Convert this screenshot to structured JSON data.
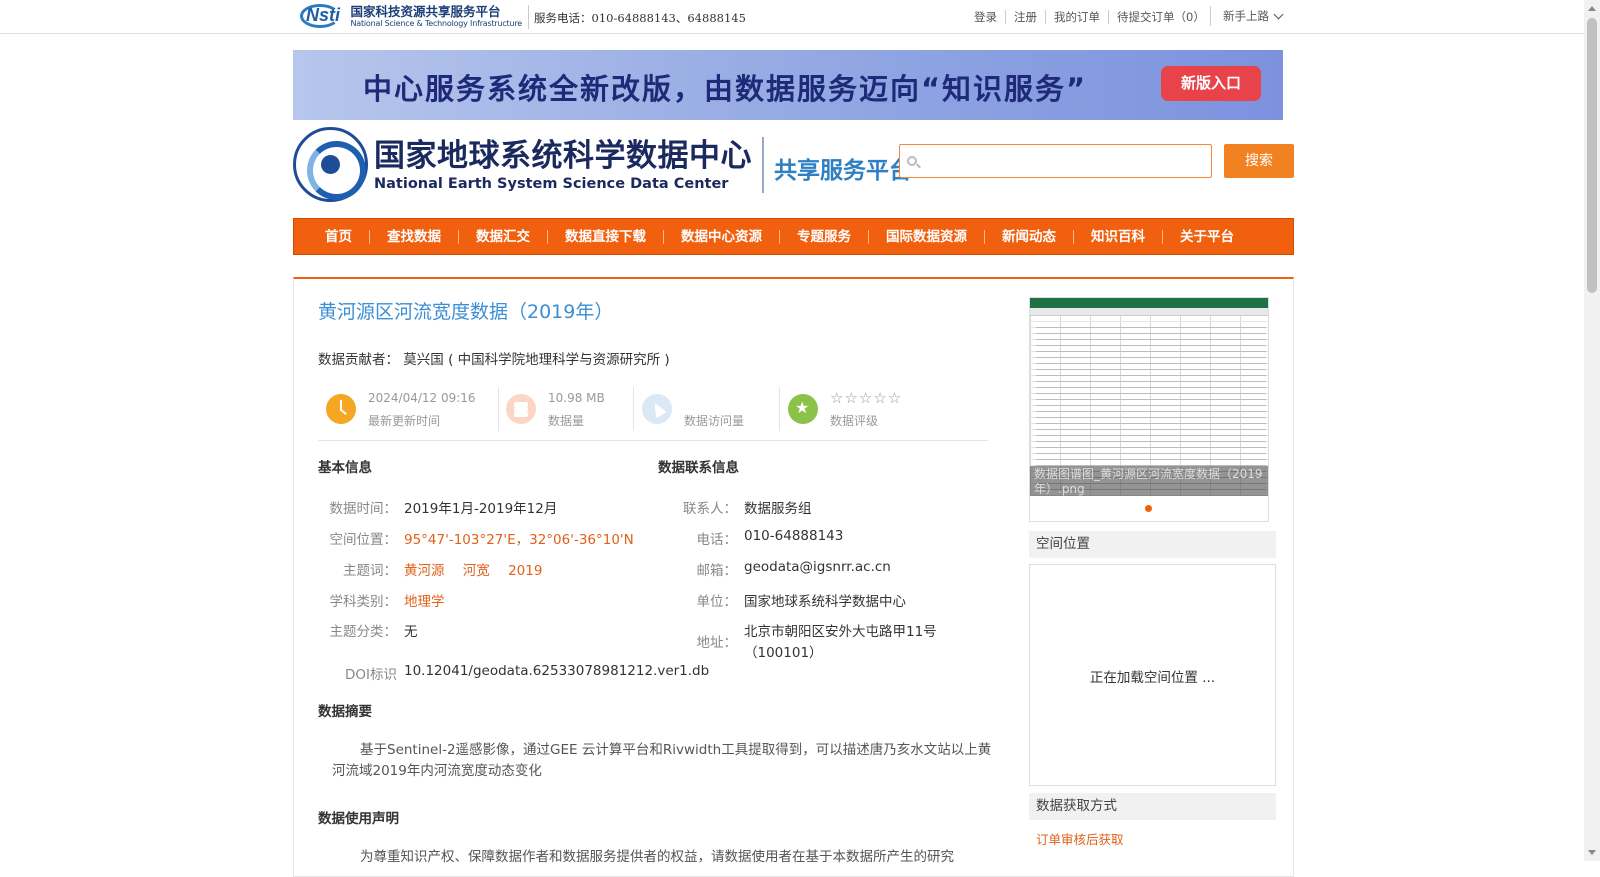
{
  "topbar": {
    "nsti_cn": "国家科技资源共享服务平台",
    "nsti_en": "National Science & Technology Infrastructure",
    "phone": "服务电话：010-64888143、64888145",
    "links": [
      "登录",
      "注册",
      "我的订单",
      "待提交订单（0）"
    ],
    "beginner": "新手上路"
  },
  "banner": {
    "text": "中心服务系统全新改版，由数据服务迈向“知识服务”",
    "button": "新版入口"
  },
  "header": {
    "logo_cn": "国家地球系统科学数据中心",
    "logo_en": "National Earth System Science Data Center",
    "platform": "共享服务平台",
    "search_placeholder": "",
    "search_button": "搜索"
  },
  "nav": [
    "首页",
    "查找数据",
    "数据汇交",
    "数据直接下载",
    "数据中心资源",
    "专题服务",
    "国际数据资源",
    "新闻动态",
    "知识百科",
    "关于平台"
  ],
  "dataset": {
    "title": "黄河源区河流宽度数据（2019年）",
    "contributor": "数据贡献者： 莫兴国 ( 中国科学院地理科学与资源研究所 )",
    "stats": {
      "updated_value": "2024/04/12 09:16",
      "updated_label": "最新更新时间",
      "size_value": "10.98 MB",
      "size_label": "数据量",
      "visits_value": "",
      "visits_label": "数据访问量",
      "rating_stars": "☆☆☆☆☆",
      "rating_label": "数据评级",
      "rating_value": 0
    },
    "basic_info": {
      "heading": "基本信息",
      "time_key": "数据时间：",
      "time_val": "2019年1月-2019年12月",
      "space_key": "空间位置：",
      "space_val": "95°47'-103°27'E，32°06'-36°10'N",
      "keywords_key": "主题词：",
      "keywords": [
        "黄河源",
        "河宽",
        "2019"
      ],
      "subject_key": "学科类别：",
      "subject_val": "地理学",
      "category_key": "主题分类：",
      "category_val": "无",
      "doi_key": "DOI标识",
      "doi_val": "10.12041/geodata.62533078981212.ver1.db"
    },
    "contact": {
      "heading": "数据联系信息",
      "person_key": "联系人：",
      "person_val": "数据服务组",
      "phone_key": "电话：",
      "phone_val": "010-64888143",
      "email_key": "邮箱：",
      "email_val": "geodata@igsnrr.ac.cn",
      "unit_key": "单位：",
      "unit_val": "国家地球系统科学数据中心",
      "address_key": "地址：",
      "address_line1": "北京市朝阳区安外大屯路甲11号",
      "address_line2": "（100101）"
    },
    "abstract_heading": "数据摘要",
    "abstract": "基于Sentinel-2遥感影像，通过GEE 云计算平台和Rivwidth工具提取得到，可以描述唐乃亥水文站以上黄河流域2019年内河流宽度动态变化",
    "usage_heading": "数据使用声明",
    "usage": "为尊重知识产权、保障数据作者和数据服务提供者的权益，请数据使用者在基于本数据所产生的研究"
  },
  "sidebar": {
    "thumb_caption": "数据图谱图_黄河源区河流宽度数据（2019年）.png",
    "space_heading": "空间位置",
    "map_loading": "正在加载空间位置 ...",
    "access_heading": "数据获取方式",
    "access_link": "订单审核后获取"
  },
  "colors": {
    "nav_bg": "#f1600f",
    "title": "#3b8fd4",
    "accent_orange": "#e0611a",
    "search_btn": "#f28221",
    "banner_btn": "#e8434a"
  }
}
